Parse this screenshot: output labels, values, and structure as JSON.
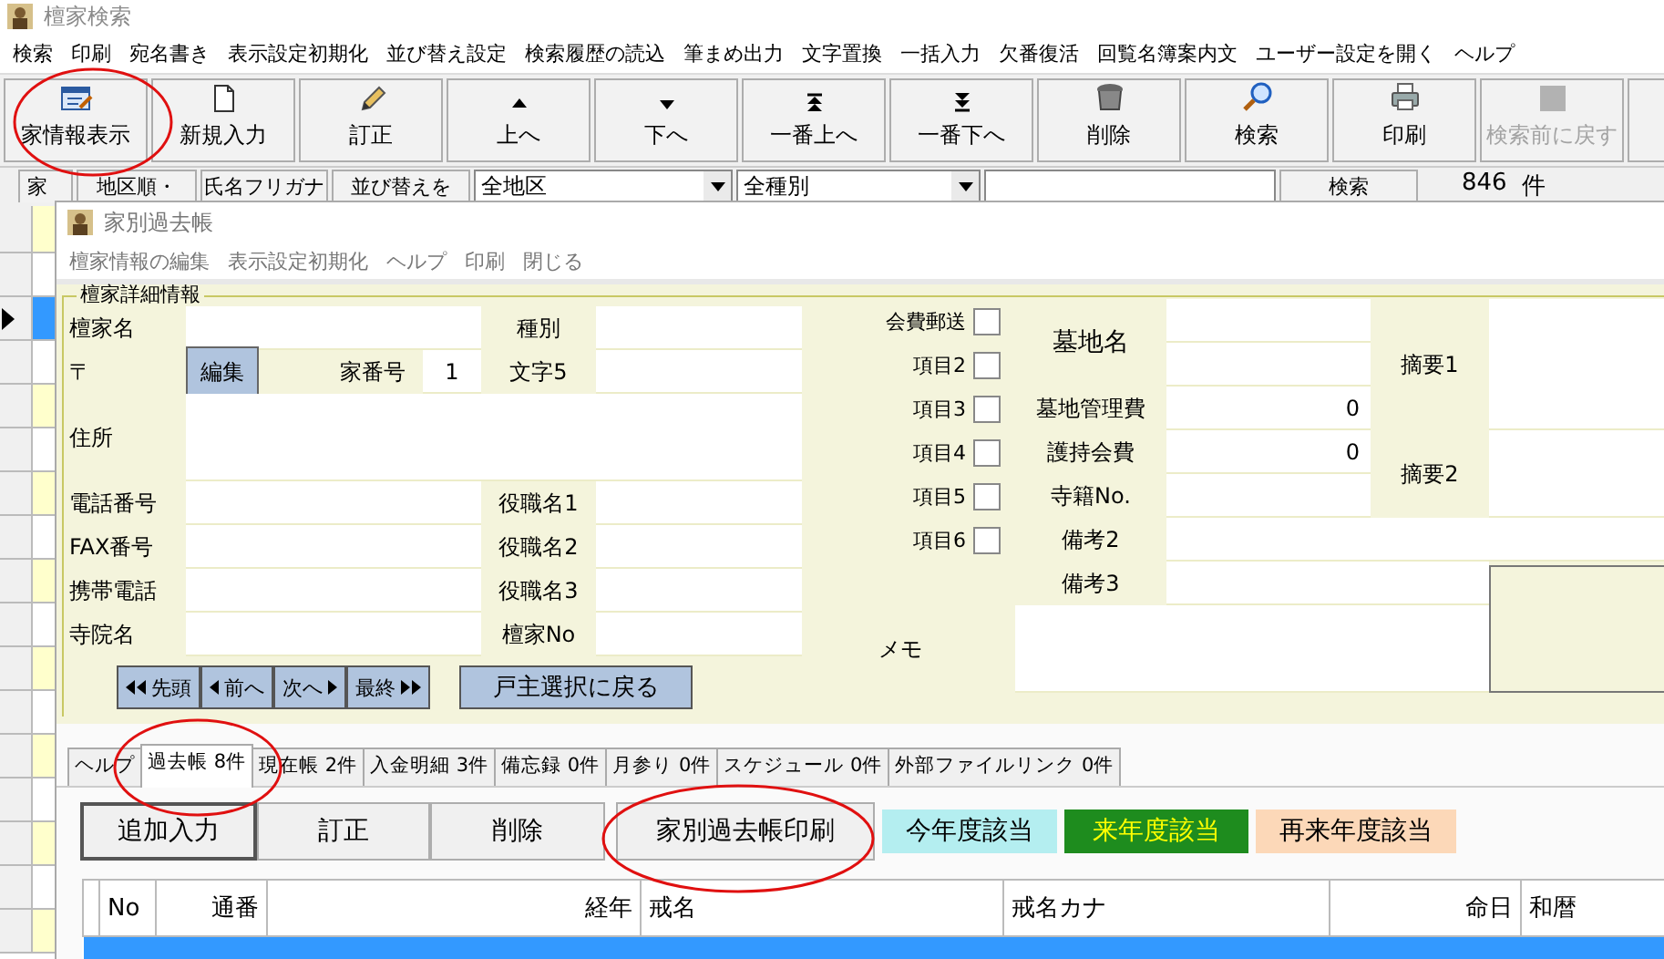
{
  "window": {
    "title": "檀家検索"
  },
  "menu": [
    "検索",
    "印刷",
    "宛名書き",
    "表示設定初期化",
    "並び替え設定",
    "検索履歴の読込",
    "筆まめ出力",
    "文字置換",
    "一括入力",
    "欠番復活",
    "回覧名簿案内文",
    "ユーザー設定を開く",
    "ヘルプ"
  ],
  "toolbar": [
    {
      "label": "家情報表示",
      "kind": "form",
      "disabled": false
    },
    {
      "label": "新規入力",
      "kind": "page",
      "disabled": false
    },
    {
      "label": "訂正",
      "kind": "pencil",
      "disabled": false
    },
    {
      "label": "上へ",
      "kind": "up",
      "disabled": false
    },
    {
      "label": "下へ",
      "kind": "down",
      "disabled": false
    },
    {
      "label": "一番上へ",
      "kind": "top",
      "disabled": false
    },
    {
      "label": "一番下へ",
      "kind": "bottom",
      "disabled": false
    },
    {
      "label": "削除",
      "kind": "trash",
      "disabled": false
    },
    {
      "label": "検索",
      "kind": "search",
      "disabled": false
    },
    {
      "label": "印刷",
      "kind": "printer",
      "disabled": false
    },
    {
      "label": "検索前に戻す",
      "kind": "back",
      "disabled": true
    }
  ],
  "filters": {
    "left_button": "家",
    "sort_buttons": [
      "地区順・",
      "氏名フリガナ",
      "並び替えを"
    ],
    "area_select": "全地区",
    "type_select": "全種別",
    "search_button": "検索",
    "count": "846",
    "count_unit": "件"
  },
  "detail_window": {
    "title": "家別過去帳",
    "menu": [
      "檀家情報の編集",
      "表示設定初期化",
      "ヘルプ",
      "印刷",
      "閉じる"
    ],
    "group_title": "檀家詳細情報",
    "name_label": "檀家名",
    "type_label": "種別",
    "zip_label": "〒",
    "edit_button": "編集",
    "house_no_label": "家番号",
    "house_no": "1",
    "char5_label": "文字5",
    "address_label": "住所",
    "rows": [
      {
        "label": "電話番号",
        "label2": "役職名1"
      },
      {
        "label": "FAX番号",
        "label2": "役職名2"
      },
      {
        "label": "携帯電話",
        "label2": "役職名3"
      },
      {
        "label": "寺院名",
        "label2": "檀家No"
      }
    ],
    "nav": [
      {
        "label": "先頭",
        "kind": "first"
      },
      {
        "label": "前へ",
        "kind": "prev"
      },
      {
        "label": "次へ",
        "kind": "next"
      },
      {
        "label": "最終",
        "kind": "last"
      }
    ],
    "back_button": "戸主選択に戻る",
    "checks": [
      {
        "label": "会費郵送",
        "checked": false
      },
      {
        "label": "項目2",
        "checked": false
      },
      {
        "label": "項目3",
        "checked": false
      },
      {
        "label": "項目4",
        "checked": false
      },
      {
        "label": "項目5",
        "checked": false
      },
      {
        "label": "項目6",
        "checked": false
      }
    ],
    "cemetery_label": "墓地名",
    "cemetery_fee_label": "墓地管理費",
    "cemetery_fee": "0",
    "support_fee_label": "護持会費",
    "support_fee": "0",
    "registry_label": "寺籍No.",
    "note2_label": "備考2",
    "note3_label": "備考3",
    "summary1_label": "摘要1",
    "summary2_label": "摘要2",
    "memo_label": "メモ"
  },
  "tabs": [
    {
      "label": "ヘルプ",
      "selected": false
    },
    {
      "label": "過去帳 8件",
      "selected": true
    },
    {
      "label": "現在帳 2件",
      "selected": false
    },
    {
      "label": "入金明細 3件",
      "selected": false
    },
    {
      "label": "備忘録 0件",
      "selected": false
    },
    {
      "label": "月参り 0件",
      "selected": false
    },
    {
      "label": "スケジュール 0件",
      "selected": false
    },
    {
      "label": "外部ファイルリンク 0件",
      "selected": false
    }
  ],
  "actions": [
    "追加入力",
    "訂正",
    "削除",
    "家別過去帳印刷"
  ],
  "legend": [
    {
      "label": "今年度該当",
      "color": "#b4eef0"
    },
    {
      "label": "来年度該当",
      "color": "#1e8c1e"
    },
    {
      "label": "再来年度該当",
      "color": "#fcd8b8"
    }
  ],
  "table": {
    "columns": [
      "No",
      "通番",
      "経年",
      "戒名",
      "戒名カナ",
      "命日",
      "和暦"
    ]
  }
}
